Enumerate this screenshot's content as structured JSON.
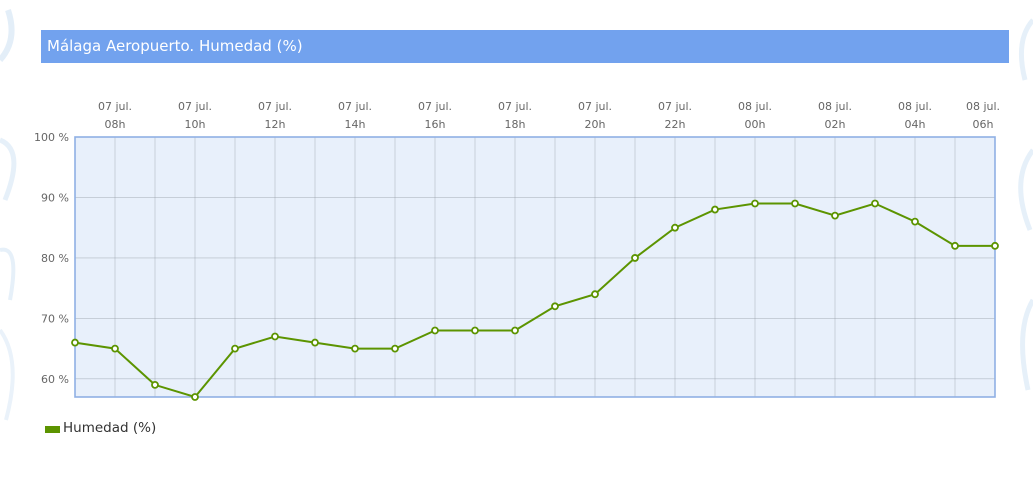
{
  "title": "Málaga Aeropuerto. Humedad (%)",
  "colors": {
    "title_bg": "#72a2ee",
    "plot_bg": "#e8f0fb",
    "plot_border": "#8fb0e4",
    "line": "#5c9400"
  },
  "legend": {
    "label": "Humedad (%)"
  },
  "chart_data": {
    "type": "line",
    "title": "Málaga Aeropuerto. Humedad (%)",
    "x_labels": [
      {
        "date": "07 jul.",
        "hour": "08h"
      },
      {
        "date": "07 jul.",
        "hour": "10h"
      },
      {
        "date": "07 jul.",
        "hour": "12h"
      },
      {
        "date": "07 jul.",
        "hour": "14h"
      },
      {
        "date": "07 jul.",
        "hour": "16h"
      },
      {
        "date": "07 jul.",
        "hour": "18h"
      },
      {
        "date": "07 jul.",
        "hour": "20h"
      },
      {
        "date": "07 jul.",
        "hour": "22h"
      },
      {
        "date": "08 jul.",
        "hour": "00h"
      },
      {
        "date": "08 jul.",
        "hour": "02h"
      },
      {
        "date": "08 jul.",
        "hour": "04h"
      },
      {
        "date": "08 jul.",
        "hour": "06h"
      }
    ],
    "x": [
      "07h",
      "08h",
      "09h",
      "10h",
      "11h",
      "12h",
      "13h",
      "14h",
      "15h",
      "16h",
      "17h",
      "18h",
      "19h",
      "20h",
      "21h",
      "22h",
      "23h",
      "00h",
      "01h",
      "02h",
      "03h",
      "04h",
      "05h",
      "06h"
    ],
    "yticks": [
      "100 %",
      "90 %",
      "80 %",
      "70 %",
      "60 %"
    ],
    "ylim": [
      57,
      100
    ],
    "grid": true,
    "legend_position": "bottom-left",
    "series": [
      {
        "name": "Humedad (%)",
        "values": [
          66,
          65,
          59,
          57,
          65,
          67,
          66,
          65,
          65,
          68,
          68,
          68,
          72,
          74,
          80,
          85,
          88,
          89,
          89,
          87,
          89,
          86,
          82,
          82
        ]
      }
    ]
  }
}
